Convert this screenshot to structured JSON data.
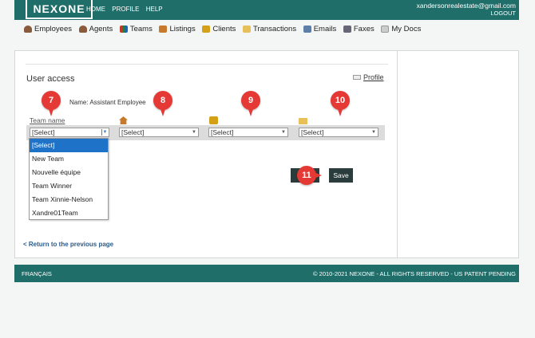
{
  "header": {
    "logo": "NEXONE",
    "nav": [
      "HOME",
      "PROFILE",
      "HELP"
    ],
    "email": "xandersonrealestate@gmail.com",
    "logout": "LOGOUT"
  },
  "main_nav": [
    {
      "label": "Employees",
      "icon": "employees-icon",
      "color": "#8a5a3c"
    },
    {
      "label": "Agents",
      "icon": "agents-icon",
      "color": "#8a5a3c"
    },
    {
      "label": "Teams",
      "icon": "teams-icon",
      "color": "#c0392b"
    },
    {
      "label": "Listings",
      "icon": "listings-icon",
      "color": "#c77a2c"
    },
    {
      "label": "Clients",
      "icon": "clients-icon",
      "color": "#d4a017"
    },
    {
      "label": "Transactions",
      "icon": "folder-icon",
      "color": "#e8c05a"
    },
    {
      "label": "Emails",
      "icon": "email-icon",
      "color": "#5b7fa8"
    },
    {
      "label": "Faxes",
      "icon": "fax-icon",
      "color": "#667"
    },
    {
      "label": "My Docs",
      "icon": "docs-icon",
      "color": "#aaa"
    }
  ],
  "page": {
    "title": "User access",
    "profile_link": "Profile",
    "name_line": "Name: Assistant Employee",
    "team_name_header": "Team name"
  },
  "selects": [
    {
      "value": "[Select]"
    },
    {
      "value": "[Select]"
    },
    {
      "value": "[Select]"
    },
    {
      "value": "[Select]"
    }
  ],
  "dropdown_options": [
    "[Select]",
    "New Team",
    "Nouvelle équipe",
    "Team Winner",
    "Team Xinnie-Nelson",
    "Xandre01Team"
  ],
  "markers": [
    "7",
    "8",
    "9",
    "10",
    "11"
  ],
  "buttons": {
    "save": "Save"
  },
  "return_link": "< Return to the previous page",
  "footer": {
    "language": "FRANÇAIS",
    "copyright": "© 2010-2021 NEXONE - ALL RIGHTS RESERVED - US PATENT PENDING"
  }
}
